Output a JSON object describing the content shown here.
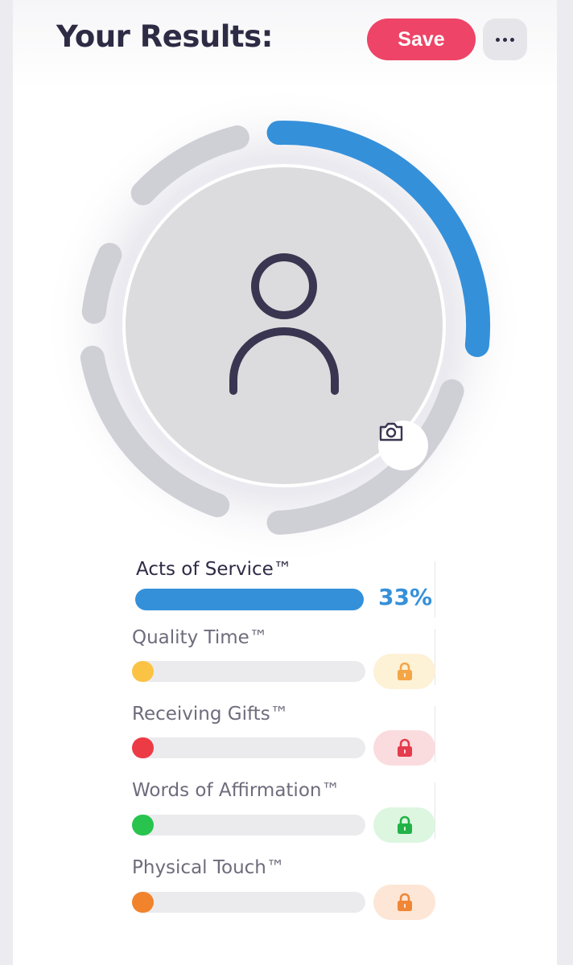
{
  "header": {
    "title": "Your Results:",
    "save_label": "Save"
  },
  "profile": {
    "avatar_icon": "person-icon",
    "camera_icon": "camera-icon",
    "accent": "#3590da",
    "track_color": "#cfcfd6"
  },
  "results": [
    {
      "label": "Acts of Service™",
      "percent_text": "33%",
      "percent": 33,
      "color": "#3590da",
      "locked": false
    },
    {
      "label": "Quality Time™",
      "color": "#fbc344",
      "lock_bg": "#fdf1d6",
      "lock_color": "#f4a647",
      "locked": true
    },
    {
      "label": "Receiving Gifts™",
      "color": "#ed3b45",
      "lock_bg": "#fadcdf",
      "lock_color": "#e53b4c",
      "locked": true
    },
    {
      "label": "Words of Affirmation™",
      "color": "#28c44e",
      "lock_bg": "#dcf6e0",
      "lock_color": "#22b348",
      "locked": true
    },
    {
      "label": "Physical Touch™",
      "color": "#f1832d",
      "lock_bg": "#fde6d6",
      "lock_color": "#f08737",
      "locked": true
    }
  ]
}
